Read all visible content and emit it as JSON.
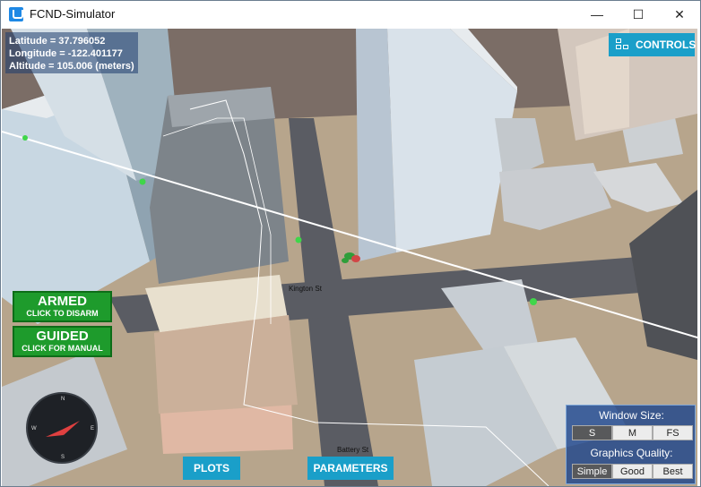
{
  "window": {
    "title": "FCND-Simulator",
    "min": "—",
    "max": "☐",
    "close": "✕"
  },
  "hud": {
    "latitude": "Latitude = 37.796052",
    "longitude": "Longitude = -122.401177",
    "altitude": "Altitude = 105.006 (meters)"
  },
  "controls": {
    "label": "CONTROLS"
  },
  "armed": {
    "title": "ARMED",
    "subtitle": "CLICK TO DISARM"
  },
  "guided": {
    "title": "GUIDED",
    "subtitle": "CLICK FOR MANUAL"
  },
  "compass": {
    "n": "N",
    "s": "S",
    "e": "E",
    "w": "W"
  },
  "bottom": {
    "plots": "PLOTS",
    "parameters": "PARAMETERS"
  },
  "streets": {
    "cross": "Kington St",
    "battery": "Battery St"
  },
  "settings": {
    "window_size_label": "Window Size:",
    "window_sizes": [
      "S",
      "M",
      "FS"
    ],
    "quality_label": "Graphics Quality:",
    "qualities": [
      "Simple",
      "Good",
      "Best"
    ]
  },
  "colors": {
    "accent": "#1a9fc9",
    "armed": "#1e9b2c"
  }
}
